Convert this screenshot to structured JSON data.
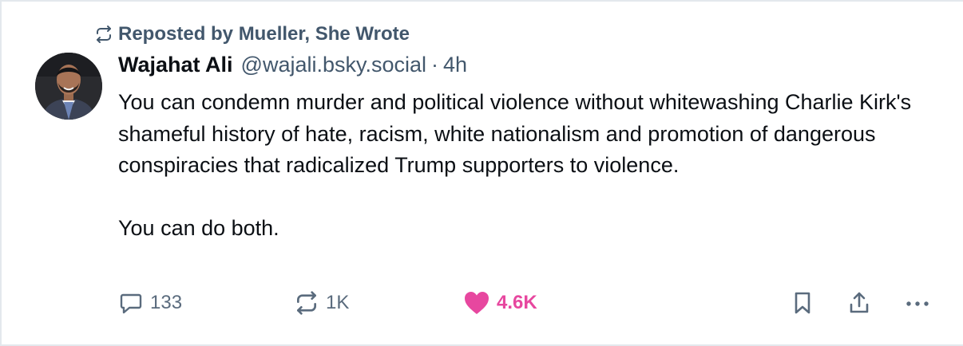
{
  "repost": {
    "label": "Reposted by Mueller, She Wrote",
    "icon": "repost-icon"
  },
  "author": {
    "name": "Wajahat Ali",
    "handle": "@wajali.bsky.social",
    "separator": "·",
    "time": "4h",
    "avatar_icon": "user-avatar"
  },
  "post": {
    "paragraphs": [
      "You can condemn murder and political violence without whitewashing Charlie Kirk's shameful history of hate, racism, white nationalism and promotion of dangerous conspiracies that radicalized Trump supporters to violence.",
      "You can do both."
    ]
  },
  "actions": {
    "reply": {
      "count": "133",
      "icon": "reply-icon"
    },
    "repost": {
      "count": "1K",
      "icon": "repost-icon"
    },
    "like": {
      "count": "4.6K",
      "icon": "heart-icon",
      "liked": true
    },
    "bookmark": {
      "icon": "bookmark-icon"
    },
    "share": {
      "icon": "share-icon"
    },
    "more": {
      "icon": "more-icon"
    }
  },
  "colors": {
    "text": "#0b0f14",
    "muted": "#42576c",
    "icon_muted": "#5a6b7d",
    "like": "#e7479f",
    "border": "#e3e8ed"
  }
}
